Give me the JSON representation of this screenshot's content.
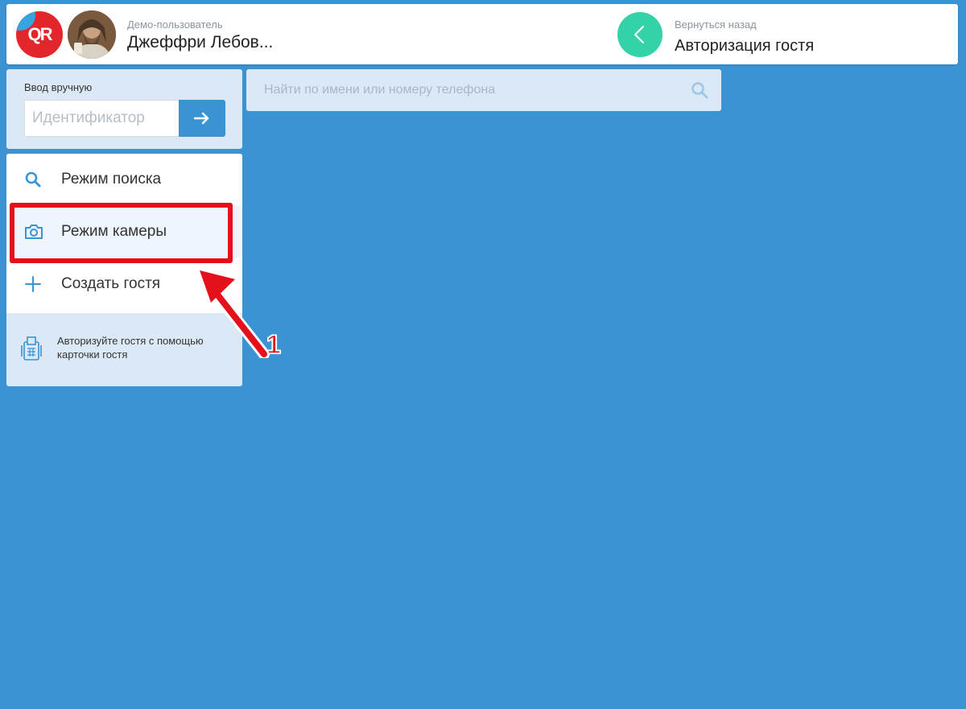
{
  "header": {
    "logo_text": "QR",
    "user_label": "Демо-пользователь",
    "user_name": "Джеффри Лебов...",
    "back_label": "Вернуться назад",
    "page_title": "Авторизация гостя"
  },
  "manual": {
    "title": "Ввод вручную",
    "placeholder": "Идентификатор",
    "value": ""
  },
  "search": {
    "placeholder": "Найти по имени или номеру телефона",
    "value": ""
  },
  "menu": {
    "items": [
      {
        "label": "Режим поиска",
        "icon": "search-icon",
        "selected": false
      },
      {
        "label": "Режим камеры",
        "icon": "camera-icon",
        "selected": true
      },
      {
        "label": "Создать гостя",
        "icon": "plus-icon",
        "selected": false
      }
    ],
    "card_hint": "Авторизуйте гостя с помощью карточки гостя"
  },
  "annotation": {
    "number": "1"
  },
  "colors": {
    "background": "#3a93d3",
    "accent": "#3a93d3",
    "back_button": "#33d3a7",
    "logo": "#e3262b",
    "annotation": "#e4101c"
  }
}
